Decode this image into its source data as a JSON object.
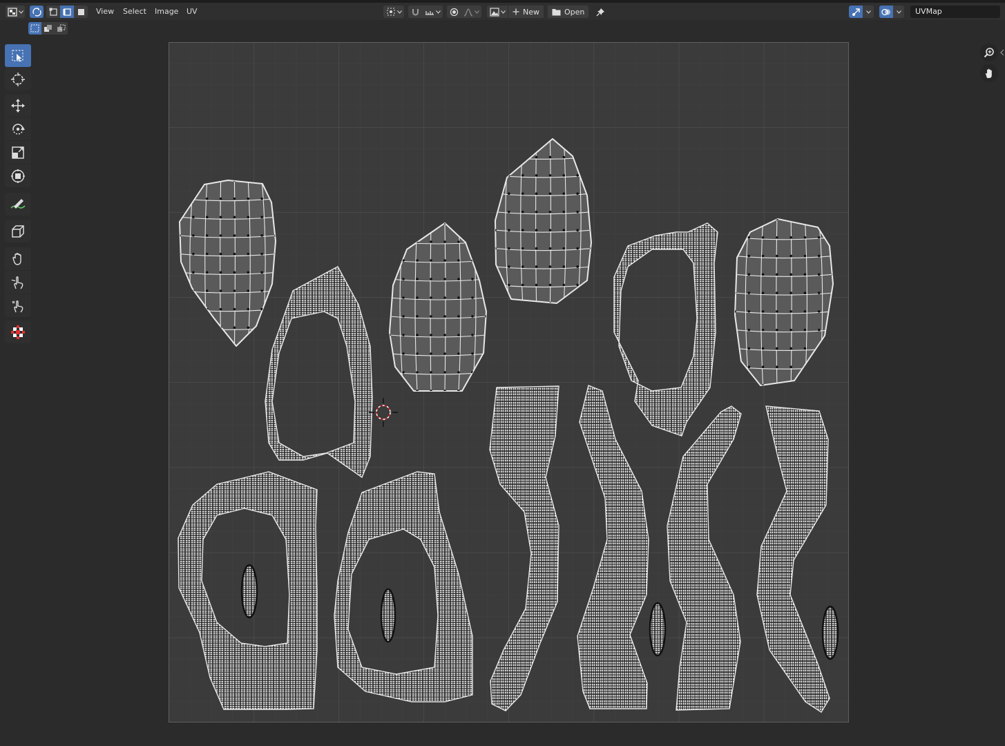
{
  "header": {
    "menus": [
      "View",
      "Select",
      "Image",
      "UV"
    ],
    "new_label": "New",
    "open_label": "Open",
    "uv_map_name": "UVMap"
  },
  "toolbar": {
    "tools": [
      "select-box-icon",
      "cursor-icon",
      "move-icon",
      "rotate-icon",
      "scale-icon",
      "transform-icon",
      "annotate-icon",
      "rip-region-icon",
      "grab-icon",
      "relax-icon",
      "pinch-icon",
      "sample-icon"
    ]
  },
  "colors": {
    "accent": "#4772b3",
    "background": "#2b2b2b",
    "header": "#2f2f2f",
    "island_fill": "#5a5a5a",
    "edge": "#e8e8e8",
    "cursor": "#cc2222"
  }
}
